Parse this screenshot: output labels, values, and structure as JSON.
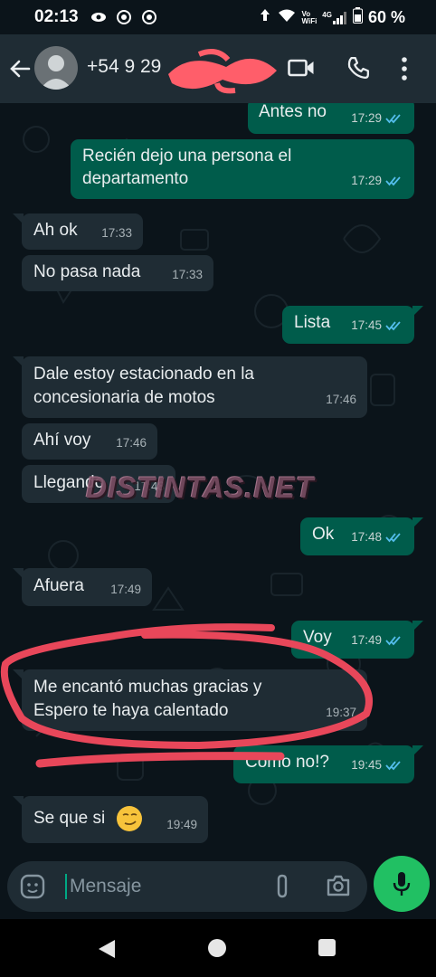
{
  "status_bar": {
    "time": "02:13",
    "wifi_label_top": "Vo",
    "wifi_label_bottom": "WiFi",
    "network": "4G",
    "battery": "60 %"
  },
  "header": {
    "contact_name": "+54 9 29"
  },
  "messages": [
    {
      "direction": "out",
      "text": "Antes no",
      "time": "17:29",
      "status": "read"
    },
    {
      "direction": "out",
      "text_line1": "Recién dejo una persona el",
      "text_line2": "departamento",
      "time": "17:29",
      "status": "read"
    },
    {
      "direction": "in",
      "text": "Ah ok",
      "time": "17:33"
    },
    {
      "direction": "in",
      "text": "No pasa nada",
      "time": "17:33"
    },
    {
      "direction": "out",
      "text": "Lista",
      "time": "17:45",
      "status": "read"
    },
    {
      "direction": "in",
      "text_line1": "Dale estoy estacionado en la",
      "text_line2": "concesionaria de motos",
      "time": "17:46"
    },
    {
      "direction": "in",
      "text": "Ahí voy",
      "time": "17:46"
    },
    {
      "direction": "in",
      "text": "Llegando",
      "time": "17:48"
    },
    {
      "direction": "out",
      "text": "Ok",
      "time": "17:48",
      "status": "read"
    },
    {
      "direction": "in",
      "text": "Afuera",
      "time": "17:49"
    },
    {
      "direction": "out",
      "text": "Voy",
      "time": "17:49",
      "status": "read"
    },
    {
      "direction": "in",
      "text_line1": "Me encantó muchas gracias y",
      "text_line2": "Espero te haya calentado",
      "time": "19:37"
    },
    {
      "direction": "out",
      "text": "Como no!?",
      "time": "19:45",
      "status": "read"
    },
    {
      "direction": "in",
      "text": "Se que si",
      "time": "19:49",
      "emoji": "smirking-face"
    }
  ],
  "watermark": "DISTINTAS.NET",
  "input": {
    "placeholder": "Mensaje"
  },
  "colors": {
    "background": "#0b141a",
    "header": "#1f2c34",
    "outgoing_bubble": "#005c4b",
    "incoming_bubble": "#1f2c34",
    "read_ticks": "#53bdeb",
    "accent": "#21c063",
    "annotation": "#e8475a"
  }
}
